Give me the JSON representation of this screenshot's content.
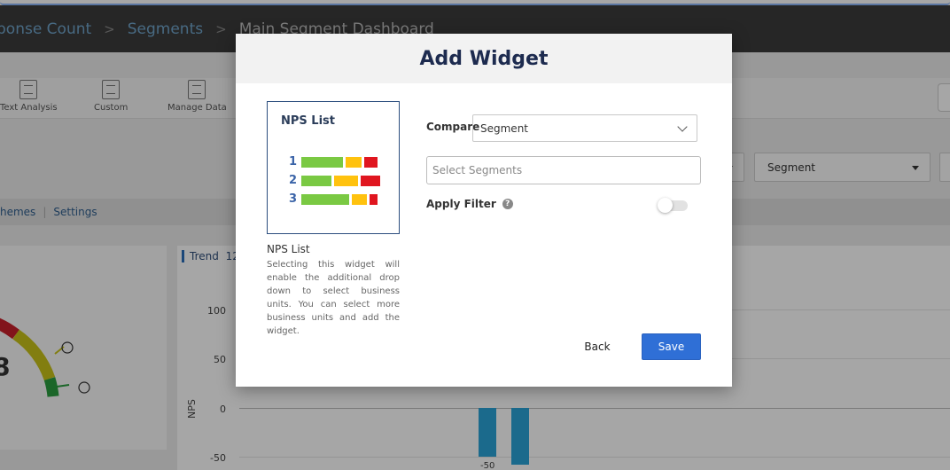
{
  "breadcrumb": {
    "items": [
      "ponse Count",
      "Segments"
    ],
    "current": "Main Segment Dashboard",
    "separator": ">"
  },
  "toolbar": {
    "text_analysis": "Text Analysis",
    "custom": "Custom",
    "manage_data": "Manage Data"
  },
  "filters": {
    "segment_select": "Segment"
  },
  "tabs": {
    "themes": "hemes",
    "settings": "Settings"
  },
  "gauge": {
    "value_fragment": "8"
  },
  "trend": {
    "title": "Trend",
    "title_suffix": "12",
    "y_axis_label": "NPS",
    "y_ticks": [
      "100",
      "50",
      "0",
      "-50"
    ],
    "bar_value_label": "-50",
    "bars": [
      -50,
      -58
    ]
  },
  "modal": {
    "title": "Add Widget",
    "widget_card": {
      "title": "NPS List",
      "rows": [
        "1",
        "2",
        "3"
      ],
      "segment_colors": [
        "#7ac943",
        "#ffc20e",
        "#e0161f"
      ],
      "row_fractions": [
        [
          0.55,
          0.21,
          0.18
        ],
        [
          0.4,
          0.31,
          0.25
        ],
        [
          0.63,
          0.2,
          0.11
        ]
      ]
    },
    "widget_name": "NPS List",
    "widget_description": "Selecting this widget will enable the additional drop down to select business units. You can select more business units and add the widget.",
    "compare_label": "Compare",
    "compare_value": "Segment",
    "segments_placeholder": "Select Segments",
    "apply_filter_label": "Apply Filter",
    "apply_filter_on": false,
    "back_label": "Back",
    "save_label": "Save"
  }
}
